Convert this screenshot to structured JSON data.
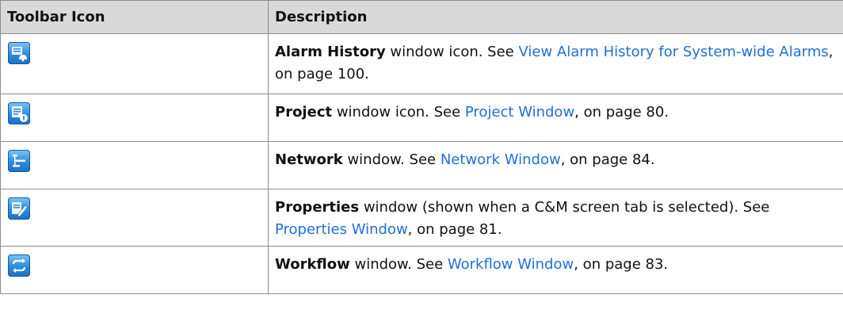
{
  "table": {
    "headers": {
      "icon": "Toolbar Icon",
      "description": "Description"
    },
    "rows": [
      {
        "icon": "alarm-history-icon",
        "title": "Alarm History",
        "pre": " window icon. See ",
        "link": "View Alarm History for System-wide Alarms",
        "post": ", on page 100."
      },
      {
        "icon": "project-window-icon",
        "title": "Project",
        "pre": " window icon. See ",
        "link": "Project Window",
        "post": ", on page 80."
      },
      {
        "icon": "network-window-icon",
        "title": "Network",
        "pre": " window. See ",
        "link": "Network Window",
        "post": ", on page 84."
      },
      {
        "icon": "properties-window-icon",
        "title": "Properties",
        "pre": " window (shown when a C&M screen tab is selected). See ",
        "link": "Properties Window",
        "post": ", on page 81."
      },
      {
        "icon": "workflow-window-icon",
        "title": "Workflow",
        "pre": " window. See ",
        "link": "Workflow Window",
        "post": ", on page 83."
      }
    ]
  },
  "colors": {
    "header_bg": "#d9d9d9",
    "border": "#8c8c8c",
    "link": "#1f6fd6",
    "icon_blue": "#2c8ce0"
  }
}
